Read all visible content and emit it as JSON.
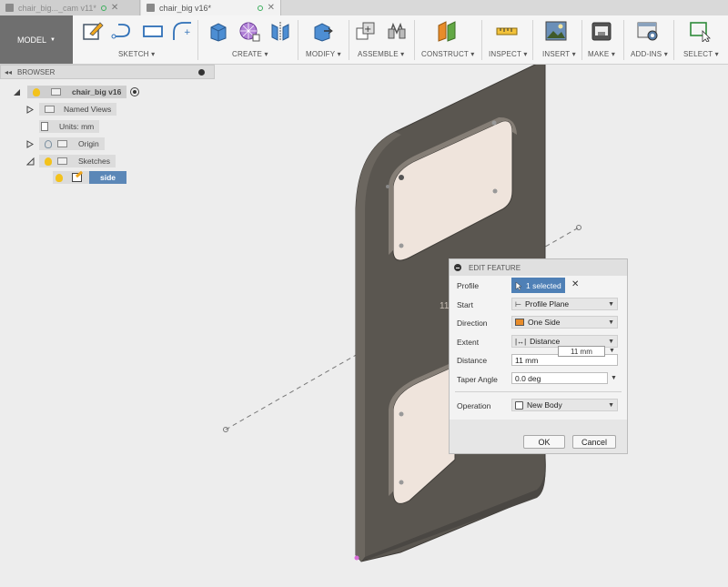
{
  "tabs": [
    {
      "title": "chair_big..._cam v11*",
      "active": false
    },
    {
      "title": "chair_big v16*",
      "active": true
    }
  ],
  "toolbar": {
    "workspace": "MODEL",
    "groups": [
      "SKETCH",
      "CREATE",
      "MODIFY",
      "ASSEMBLE",
      "CONSTRUCT",
      "INSPECT",
      "INSERT",
      "MAKE",
      "ADD-INS",
      "SELECT"
    ]
  },
  "browser": {
    "title": "BROWSER",
    "root": "chair_big v16",
    "nodes": [
      "Named Views",
      "Units: mm",
      "Origin",
      "Sketches"
    ],
    "sketch": "side"
  },
  "viewport": {
    "dimension_label": "11"
  },
  "dialog": {
    "title": "EDIT FEATURE",
    "profile_label": "Profile",
    "profile_value": "1 selected",
    "start_label": "Start",
    "start_value": "Profile Plane",
    "direction_label": "Direction",
    "direction_value": "One Side",
    "extent_label": "Extent",
    "extent_value": "Distance",
    "distance_label": "Distance",
    "distance_value": "11 mm",
    "distance_popup": "11 mm",
    "taper_label": "Taper Angle",
    "taper_value": "0.0 deg",
    "operation_label": "Operation",
    "operation_value": "New Body",
    "ok": "OK",
    "cancel": "Cancel"
  },
  "colors": {
    "panel": "#5a5650",
    "panel_edge": "#3f3c38",
    "window_fill": "#efe4dc",
    "highlight": "#5b87b7"
  }
}
